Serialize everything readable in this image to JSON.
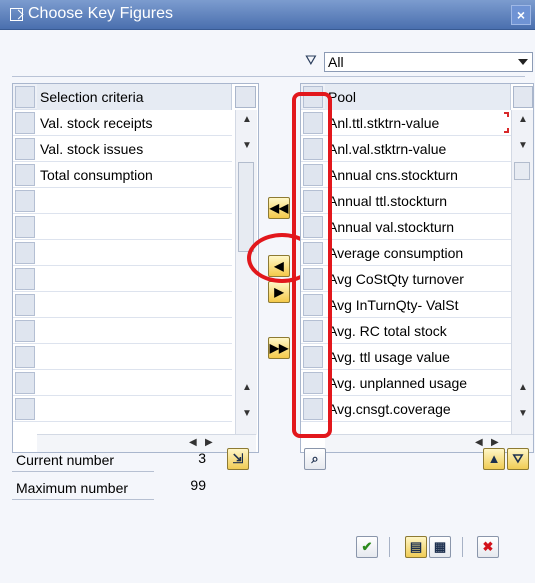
{
  "window": {
    "title": "Choose Key Figures",
    "close_label": "×"
  },
  "left_table": {
    "header": "Selection criteria",
    "rows": [
      "Val. stock receipts",
      "Val. stock issues",
      "Total consumption",
      "",
      "",
      "",
      "",
      "",
      "",
      "",
      "",
      ""
    ]
  },
  "right_table": {
    "filter_value": "All",
    "header": "Pool",
    "rows": [
      "Anl.ttl.stktrn-value",
      "Anl.val.stktrn-value",
      "Annual cns.stockturn",
      "Annual ttl.stockturn",
      "Annual val.stockturn",
      "Average consumption",
      "Avg CoStQty turnover",
      "Avg InTurnQty- ValSt",
      "Avg. RC total stock",
      "Avg. ttl usage value",
      "Avg. unplanned usage",
      "Avg.cnsgt.coverage"
    ]
  },
  "move_buttons": {
    "all_left": "◀◀",
    "one_left": "◀",
    "one_right": "▶",
    "all_right": "▶▶"
  },
  "stats": {
    "current_label": "Current number",
    "current_value": "3",
    "max_label": "Maximum number",
    "max_value": "99"
  },
  "icons": {
    "filter": "funnel-icon",
    "find": "binoculars-icon",
    "sort_asc": "sort-ascending-icon",
    "sort_desc": "sort-descending-icon",
    "confirm": "checkmark-icon",
    "cancel": "cancel-icon"
  },
  "colors": {
    "title_bar": "#4a6fae",
    "highlight": "#e2171c",
    "button_yellow": "#f4c94a"
  }
}
